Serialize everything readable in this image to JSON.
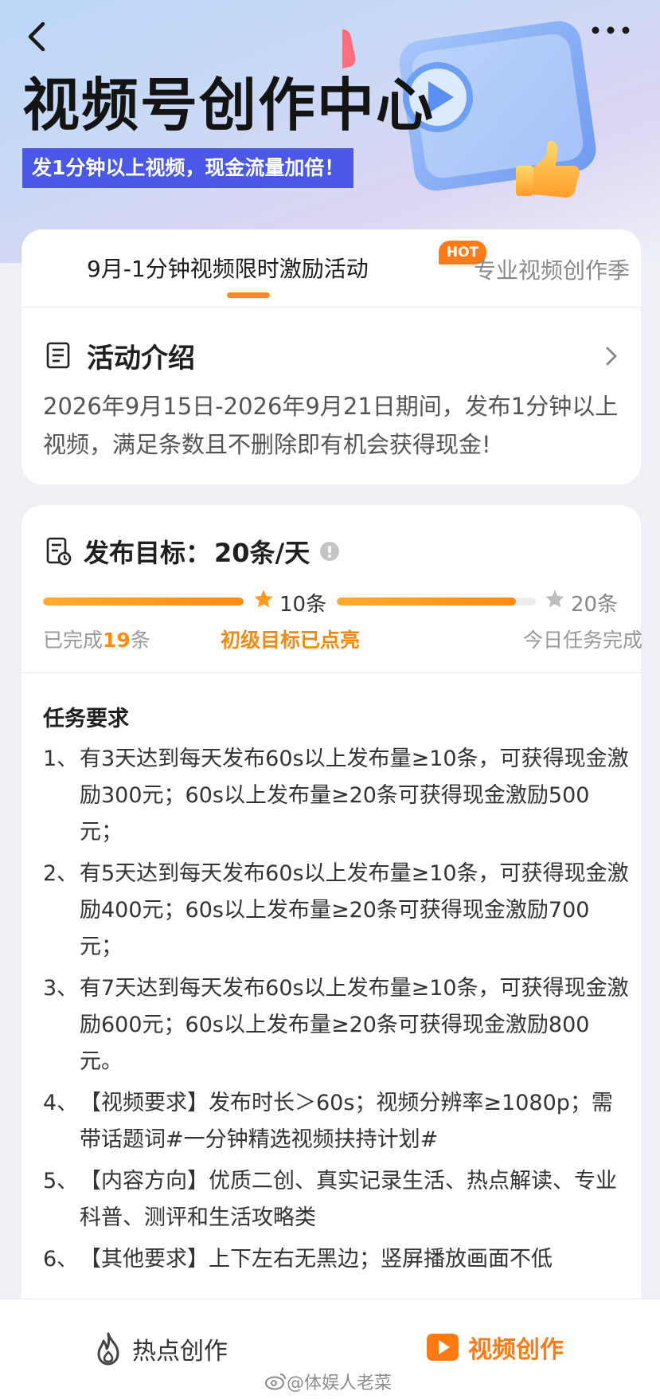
{
  "header": {
    "title": "视频号创作中心",
    "subtitle": "发1分钟以上视频，现金流量加倍！"
  },
  "tabs": {
    "active_label": "9月-1分钟视频限时激励活动",
    "badge": "HOT",
    "next_label": "专业视频创作季"
  },
  "intro": {
    "title": "活动介绍",
    "text": "2026年9月15日-2026年9月21日期间，发布1分钟以上视频，满足条数且不删除即有机会获得现金!"
  },
  "target": {
    "title": "发布目标：",
    "value": "20条/天",
    "milestone1": "10条",
    "milestone2": "20条",
    "done_prefix": "已完成",
    "done_count": "19",
    "done_suffix": "条",
    "level_text": "初级目标已点亮",
    "today_text": "今日任务完成",
    "progress_segment1": 1.0,
    "progress_segment2": 0.9
  },
  "requirements": {
    "title": "任务要求",
    "items": [
      {
        "num": "1、",
        "text": "有3天达到每天发布60s以上发布量≥10条，可获得现金激励300元；60s以上发布量≥20条可获得现金激励500元；"
      },
      {
        "num": "2、",
        "text": "有5天达到每天发布60s以上发布量≥10条，可获得现金激励400元；60s以上发布量≥20条可获得现金激励700元；"
      },
      {
        "num": "3、",
        "text": "有7天达到每天发布60s以上发布量≥10条，可获得现金激励600元；60s以上发布量≥20条可获得现金激励800元。"
      },
      {
        "num": "4、",
        "text": "【视频要求】发布时长＞60s；视频分辨率≥1080p；需带话题词#一分钟精选视频扶持计划#"
      },
      {
        "num": "5、",
        "text": "【内容方向】优质二创、真实记录生活、热点解读、专业科普、测评和生活攻略类"
      },
      {
        "num": "6、",
        "text": "【其他要求】上下左右无黑边；竖屏播放画面不低"
      }
    ]
  },
  "bottom_nav": {
    "hot_label": "热点创作",
    "video_label": "视频创作"
  },
  "watermark": "@体娱人老菜",
  "colors": {
    "accent": "#ff8a12",
    "subtitle_bg": "#4b57e6",
    "hot_badge": "#ff7a18"
  }
}
